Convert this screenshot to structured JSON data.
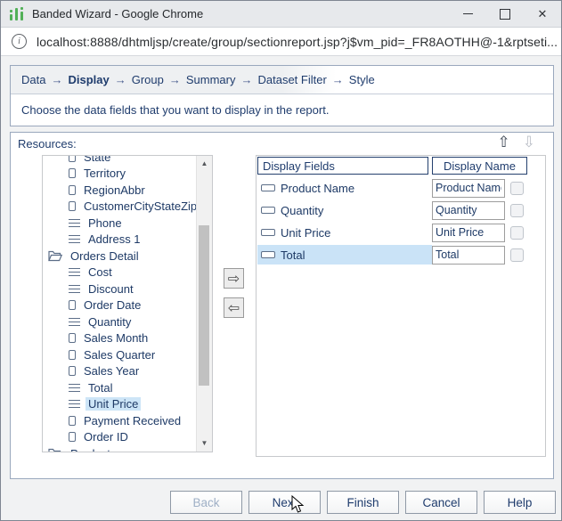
{
  "window": {
    "title": "Banded Wizard - Google Chrome",
    "controls": {
      "minimize": "minimize",
      "maximize": "maximize",
      "close": "✕"
    }
  },
  "address_bar": {
    "info_icon": "i",
    "url": "localhost:8888/dhtmljsp/create/group/sectionreport.jsp?j$vm_pid=_FR8AOTHH@-1&rptseti..."
  },
  "breadcrumb": {
    "separator": "→",
    "steps": [
      {
        "label": "Data",
        "active": false
      },
      {
        "label": "Display",
        "active": true
      },
      {
        "label": "Group",
        "active": false
      },
      {
        "label": "Summary",
        "active": false
      },
      {
        "label": "Dataset Filter",
        "active": false
      },
      {
        "label": "Style",
        "active": false
      }
    ]
  },
  "instruction": "Choose the data fields that you want to display in the report.",
  "resources": {
    "label": "Resources:",
    "tree": [
      {
        "label": "State",
        "icon": "column",
        "indent": 1,
        "selected": false
      },
      {
        "label": "Territory",
        "icon": "column",
        "indent": 1,
        "selected": false
      },
      {
        "label": "RegionAbbr",
        "icon": "column",
        "indent": 1,
        "selected": false
      },
      {
        "label": "CustomerCityStateZip",
        "icon": "column",
        "indent": 1,
        "selected": false
      },
      {
        "label": "Phone",
        "icon": "lines",
        "indent": 1,
        "selected": false
      },
      {
        "label": "Address 1",
        "icon": "lines",
        "indent": 1,
        "selected": false
      },
      {
        "label": "Orders Detail",
        "icon": "folder",
        "indent": 0,
        "selected": false
      },
      {
        "label": "Cost",
        "icon": "lines",
        "indent": 1,
        "selected": false
      },
      {
        "label": "Discount",
        "icon": "lines",
        "indent": 1,
        "selected": false
      },
      {
        "label": "Order Date",
        "icon": "column",
        "indent": 1,
        "selected": false
      },
      {
        "label": "Quantity",
        "icon": "lines",
        "indent": 1,
        "selected": false
      },
      {
        "label": "Sales Month",
        "icon": "column",
        "indent": 1,
        "selected": false
      },
      {
        "label": "Sales Quarter",
        "icon": "column",
        "indent": 1,
        "selected": false
      },
      {
        "label": "Sales Year",
        "icon": "column",
        "indent": 1,
        "selected": false
      },
      {
        "label": "Total",
        "icon": "lines",
        "indent": 1,
        "selected": false
      },
      {
        "label": "Unit Price",
        "icon": "lines",
        "indent": 1,
        "selected": true
      },
      {
        "label": "Payment Received",
        "icon": "column",
        "indent": 1,
        "selected": false
      },
      {
        "label": "Order ID",
        "icon": "column",
        "indent": 1,
        "selected": false
      },
      {
        "label": "Products",
        "icon": "folder",
        "indent": 0,
        "selected": false
      }
    ]
  },
  "reorder_buttons": {
    "up": "⇧",
    "down": "⇩",
    "up_enabled": true,
    "down_enabled": false
  },
  "transfer_buttons": {
    "add": "⇨",
    "remove": "⇦"
  },
  "display_table": {
    "columns": [
      "Display Fields",
      "Display Name"
    ],
    "rows": [
      {
        "field": "Product Name",
        "display_name": "Product Name",
        "selected": false,
        "checked": false
      },
      {
        "field": "Quantity",
        "display_name": "Quantity",
        "selected": false,
        "checked": false
      },
      {
        "field": "Unit Price",
        "display_name": "Unit Price",
        "selected": false,
        "checked": false
      },
      {
        "field": "Total",
        "display_name": "Total",
        "selected": true,
        "checked": false
      }
    ]
  },
  "footer_buttons": [
    {
      "label": "Back",
      "disabled": true
    },
    {
      "label": "Next",
      "disabled": false
    },
    {
      "label": "Finish",
      "disabled": false
    },
    {
      "label": "Cancel",
      "disabled": false
    },
    {
      "label": "Help",
      "disabled": false
    }
  ],
  "colors": {
    "accent_text": "#1f3c6d",
    "selection": "#cde5f7",
    "app_icon_green": "#52b058",
    "panel_border": "#9aa8bd"
  }
}
